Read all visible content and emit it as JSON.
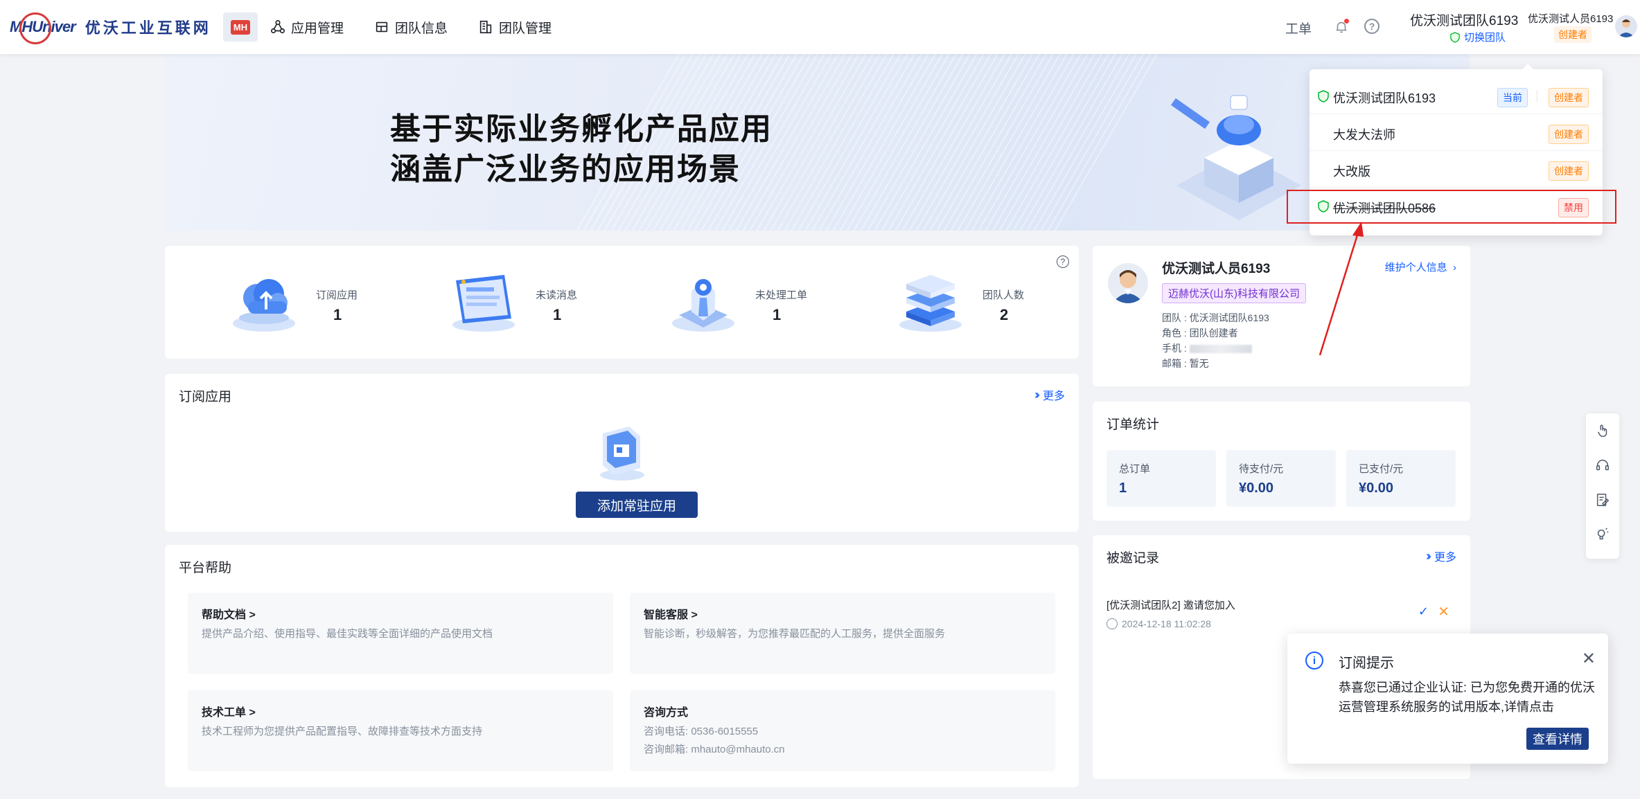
{
  "header": {
    "logo_text": "MHUniver",
    "logo_cn": "优沃工业互联网",
    "badge": "MH",
    "nav": [
      "应用管理",
      "团队信息",
      "团队管理"
    ],
    "ticket": "工单",
    "team_name": "优沃测试团队6193",
    "switch_team": "切换团队",
    "user_name": "优沃测试人员6193",
    "role_tag": "创建者"
  },
  "banner": {
    "line1": "基于实际业务孵化产品应用",
    "line2": "涵盖广泛业务的应用场景"
  },
  "stats": [
    {
      "label": "订阅应用",
      "value": "1"
    },
    {
      "label": "未读消息",
      "value": "1"
    },
    {
      "label": "未处理工单",
      "value": "1"
    },
    {
      "label": "团队人数",
      "value": "2"
    }
  ],
  "subscribed": {
    "title": "订阅应用",
    "more": "更多",
    "add_button": "添加常驻应用"
  },
  "help": {
    "title": "平台帮助",
    "items": [
      {
        "title": "帮助文档 >",
        "desc": "提供产品介绍、使用指导、最佳实践等全面详细的产品使用文档"
      },
      {
        "title": "智能客服 >",
        "desc": "智能诊断，秒级解答，为您推荐最匹配的人工服务，提供全面服务"
      },
      {
        "title": "技术工单 >",
        "desc": "技术工程师为您提供产品配置指导、故障排查等技术方面支持"
      },
      {
        "title": "咨询方式",
        "desc": "咨询电话: 0536-6015555",
        "desc2": "咨询邮箱: mhauto@mhauto.cn"
      }
    ]
  },
  "profile": {
    "name": "优沃测试人员6193",
    "company": "迈赫优沃(山东)科技有限公司",
    "team": "团队 : 优沃测试团队6193",
    "role": "角色 : 团队创建者",
    "phone": "手机 :",
    "email": "邮箱 : 暂无",
    "maintain": "维护个人信息"
  },
  "orders": {
    "title": "订单统计",
    "items": [
      {
        "label": "总订单",
        "value": "1"
      },
      {
        "label": "待支付/元",
        "value": "¥0.00"
      },
      {
        "label": "已支付/元",
        "value": "¥0.00"
      }
    ]
  },
  "invites": {
    "title": "被邀记录",
    "more": "更多",
    "record": "[优沃测试团队2] 邀请您加入",
    "time": "2024-12-18 11:02:28"
  },
  "dropdown": {
    "teams": [
      {
        "name": "优沃测试团队6193",
        "current": "当前",
        "tag": "创建者"
      },
      {
        "name": "大发大法师",
        "tag": "创建者"
      },
      {
        "name": "大改版",
        "tag": "创建者"
      },
      {
        "name": "优沃测试团队0586",
        "tag": "禁用"
      }
    ]
  },
  "notice": {
    "title": "订阅提示",
    "body": "恭喜您已通过企业认证: 已为您免费开通的优沃运营管理系统服务的试用版本,详情点击",
    "button": "查看详情"
  },
  "colors": {
    "primary": "#1b3f8b",
    "link": "#165dff",
    "warning": "#ff7d00",
    "danger": "#f53f3f",
    "highlight_box": "#e02020"
  }
}
